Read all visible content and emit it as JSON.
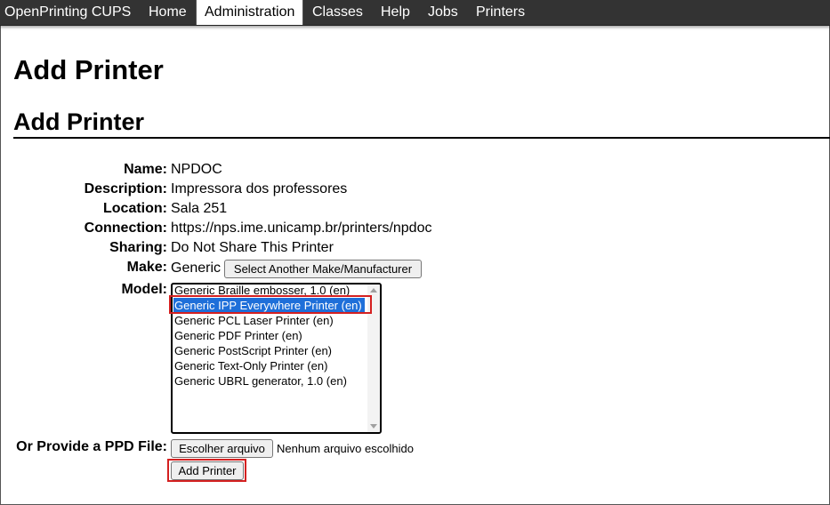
{
  "nav": {
    "items": [
      {
        "label": "OpenPrinting CUPS",
        "active": false
      },
      {
        "label": "Home",
        "active": false
      },
      {
        "label": "Administration",
        "active": true
      },
      {
        "label": "Classes",
        "active": false
      },
      {
        "label": "Help",
        "active": false
      },
      {
        "label": "Jobs",
        "active": false
      },
      {
        "label": "Printers",
        "active": false
      }
    ]
  },
  "page": {
    "title": "Add Printer",
    "section_title": "Add Printer"
  },
  "form": {
    "name_label": "Name:",
    "name_value": "NPDOC",
    "description_label": "Description:",
    "description_value": "Impressora dos professores",
    "location_label": "Location:",
    "location_value": "Sala 251",
    "connection_label": "Connection:",
    "connection_value": "https://nps.ime.unicamp.br/printers/npdoc",
    "sharing_label": "Sharing:",
    "sharing_value": "Do Not Share This Printer",
    "make_label": "Make:",
    "make_value": "Generic",
    "make_button": "Select Another Make/Manufacturer",
    "model_label": "Model:",
    "models": [
      "Generic Braille embosser, 1.0 (en)",
      "Generic IPP Everywhere Printer (en)",
      "Generic PCL Laser Printer (en)",
      "Generic PDF Printer (en)",
      "Generic PostScript Printer (en)",
      "Generic Text-Only Printer (en)",
      "Generic UBRL generator, 1.0 (en)"
    ],
    "selected_model": "Generic IPP Everywhere Printer (en)",
    "ppd_label": "Or Provide a PPD File:",
    "file_button": "Escolher arquivo",
    "file_status": "Nenhum arquivo escolhido",
    "submit_button": "Add Printer"
  },
  "colors": {
    "navbar": "#333333",
    "selection": "#1e6fd9",
    "highlight": "#d42020"
  }
}
